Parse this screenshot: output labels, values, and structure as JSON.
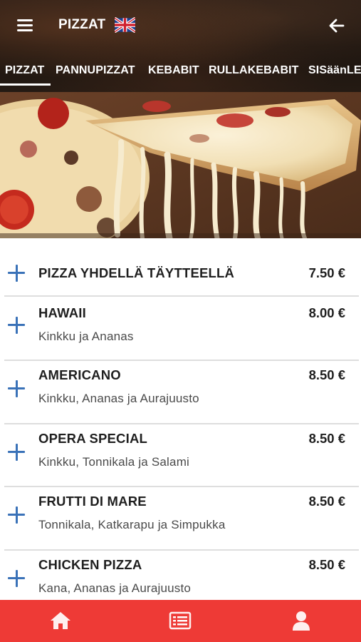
{
  "header": {
    "title": "PIZZAT",
    "menu_icon": "hamburger-menu-icon",
    "language_icon": "uk-flag-icon",
    "back_icon": "arrow-left-icon"
  },
  "tabs": [
    {
      "label": "PIZZAT",
      "active": true
    },
    {
      "label": "PANNUPIZZAT",
      "active": false
    },
    {
      "label": "KEBABIT",
      "active": false
    },
    {
      "label": "RULLAKEBABIT",
      "active": false
    },
    {
      "label": "SISäänLE",
      "active": false
    }
  ],
  "menu_items": [
    {
      "name": "PIZZA YHDELLÄ TÄYTTEELLÄ",
      "description": "",
      "price": "7.50 €"
    },
    {
      "name": "HAWAII",
      "description": "Kinkku ja Ananas",
      "price": "8.00 €"
    },
    {
      "name": "AMERICANO",
      "description": "Kinkku, Ananas ja Aurajuusto",
      "price": "8.50 €"
    },
    {
      "name": "OPERA SPECIAL",
      "description": "Kinkku, Tonnikala ja Salami",
      "price": "8.50 €"
    },
    {
      "name": "FRUTTI DI MARE",
      "description": "Tonnikala, Katkarapu ja Simpukka",
      "price": "8.50 €"
    },
    {
      "name": "CHICKEN PIZZA",
      "description": "Kana, Ananas ja Aurajuusto",
      "price": "8.50 €"
    }
  ],
  "bottom_nav": [
    {
      "icon": "home-icon"
    },
    {
      "icon": "menu-list-icon"
    },
    {
      "icon": "user-icon"
    }
  ],
  "colors": {
    "accent": "#ee3a36",
    "plus": "#3a72b8",
    "header_bg": "#1d1510"
  }
}
